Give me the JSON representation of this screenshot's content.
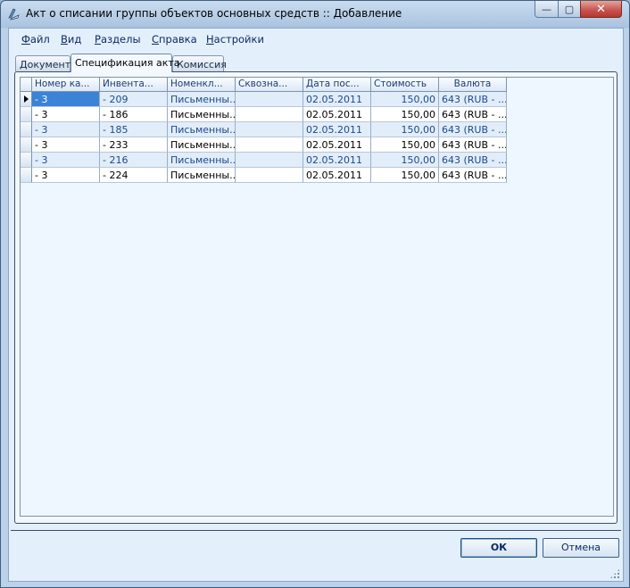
{
  "window": {
    "title": "Акт о списании группы объектов основных средств :: Добавление",
    "min_glyph": "—",
    "max_glyph": "▢",
    "close_glyph": "✕"
  },
  "menu": {
    "items": [
      {
        "prefix": "",
        "u": "Ф",
        "rest": "айл"
      },
      {
        "prefix": "",
        "u": "В",
        "rest": "ид"
      },
      {
        "prefix": "",
        "u": "Р",
        "rest": "азделы"
      },
      {
        "prefix": "",
        "u": "С",
        "rest": "правка"
      },
      {
        "prefix": "",
        "u": "Н",
        "rest": "астройки"
      }
    ]
  },
  "tabs": [
    {
      "label": "Документ"
    },
    {
      "label": "Спецификация акта"
    },
    {
      "label": "Комиссия"
    }
  ],
  "grid": {
    "columns": [
      {
        "label": "Номер ка..."
      },
      {
        "label": "Инвента..."
      },
      {
        "label": "Номенкл..."
      },
      {
        "label": "Сквозна..."
      },
      {
        "label": "Дата пос..."
      },
      {
        "label": "Стоимость"
      },
      {
        "label": "Валюта"
      }
    ],
    "rows": [
      {
        "c1": " - 3",
        "c2": " - 209",
        "c3": "Письменны...",
        "c4": "",
        "c5": "02.05.2011",
        "c6": "150,00",
        "c7": "643 (RUB - ..."
      },
      {
        "c1": " - 3",
        "c2": " - 186",
        "c3": "Письменны...",
        "c4": "",
        "c5": "02.05.2011",
        "c6": "150,00",
        "c7": "643 (RUB - ..."
      },
      {
        "c1": " - 3",
        "c2": " - 185",
        "c3": "Письменны...",
        "c4": "",
        "c5": "02.05.2011",
        "c6": "150,00",
        "c7": "643 (RUB - ..."
      },
      {
        "c1": " - 3",
        "c2": " - 233",
        "c3": "Письменны...",
        "c4": "",
        "c5": "02.05.2011",
        "c6": "150,00",
        "c7": "643 (RUB - ..."
      },
      {
        "c1": " - 3",
        "c2": " - 216",
        "c3": "Письменны...",
        "c4": "",
        "c5": "02.05.2011",
        "c6": "150,00",
        "c7": "643 (RUB - ..."
      },
      {
        "c1": " - 3",
        "c2": " - 224",
        "c3": "Письменны...",
        "c4": "",
        "c5": "02.05.2011",
        "c6": "150,00",
        "c7": "643 (RUB - ..."
      }
    ]
  },
  "buttons": {
    "ok": "ОК",
    "cancel": "Отмена"
  }
}
